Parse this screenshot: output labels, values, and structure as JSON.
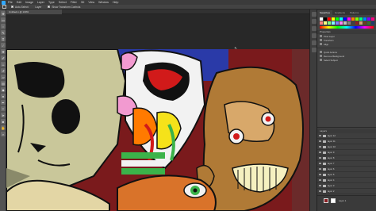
{
  "menubar": {
    "items": [
      "File",
      "Edit",
      "Image",
      "Layer",
      "Type",
      "Select",
      "Filter",
      "3D",
      "View",
      "Window",
      "Help"
    ]
  },
  "options": {
    "auto_select": "Auto-Select:",
    "layer_value": "Layer",
    "show_transform": "Show Transform Controls"
  },
  "document": {
    "tab_label": "Untitled-1 @ 100%"
  },
  "toolbar": {
    "tools": [
      "move",
      "marquee",
      "lasso",
      "quick-select",
      "crop",
      "eyedropper",
      "heal",
      "brush",
      "stamp",
      "history",
      "eraser",
      "gradient",
      "blur",
      "dodge",
      "pen",
      "type",
      "path-select",
      "shape",
      "hand",
      "zoom"
    ]
  },
  "panels": {
    "tabs": [
      "Swatches",
      "Gradients",
      "Patterns"
    ],
    "swatch_colors": [
      "#ffffff",
      "#000000",
      "#ff0000",
      "#ffff00",
      "#00ff00",
      "#00ffff",
      "#0000ff",
      "#ff00ff",
      "#ff8000",
      "#80ff00",
      "#00ff80",
      "#0080ff",
      "#8000ff",
      "#ff0080",
      "#ff8080",
      "#ffff80",
      "#80ff80",
      "#80ffff",
      "#8080ff",
      "#ff80ff",
      "#c0c0c0",
      "#808080",
      "#404040",
      "#8a1e22",
      "#d4a373",
      "#6b3f1f",
      "#3a6b2a",
      "#1f3a6b"
    ],
    "properties_title": "Properties",
    "properties": [
      "Pixel Layer",
      "Transform",
      "Align",
      "Quick Actions",
      "Remove Background",
      "Select Subject"
    ],
    "layers_title": "Layers",
    "layers": [
      "layer 12",
      "layer 11",
      "layer 10",
      "layer 9",
      "layer 8",
      "layer 7",
      "layer 6",
      "layer 5",
      "layer 4",
      "layer 3",
      "layer 2",
      "layer 1"
    ]
  },
  "footer": {
    "label": "Layer 1"
  },
  "colors": {
    "accent": "#31a8ff",
    "foreground": "#8a1e22",
    "background": "#ffffff"
  }
}
